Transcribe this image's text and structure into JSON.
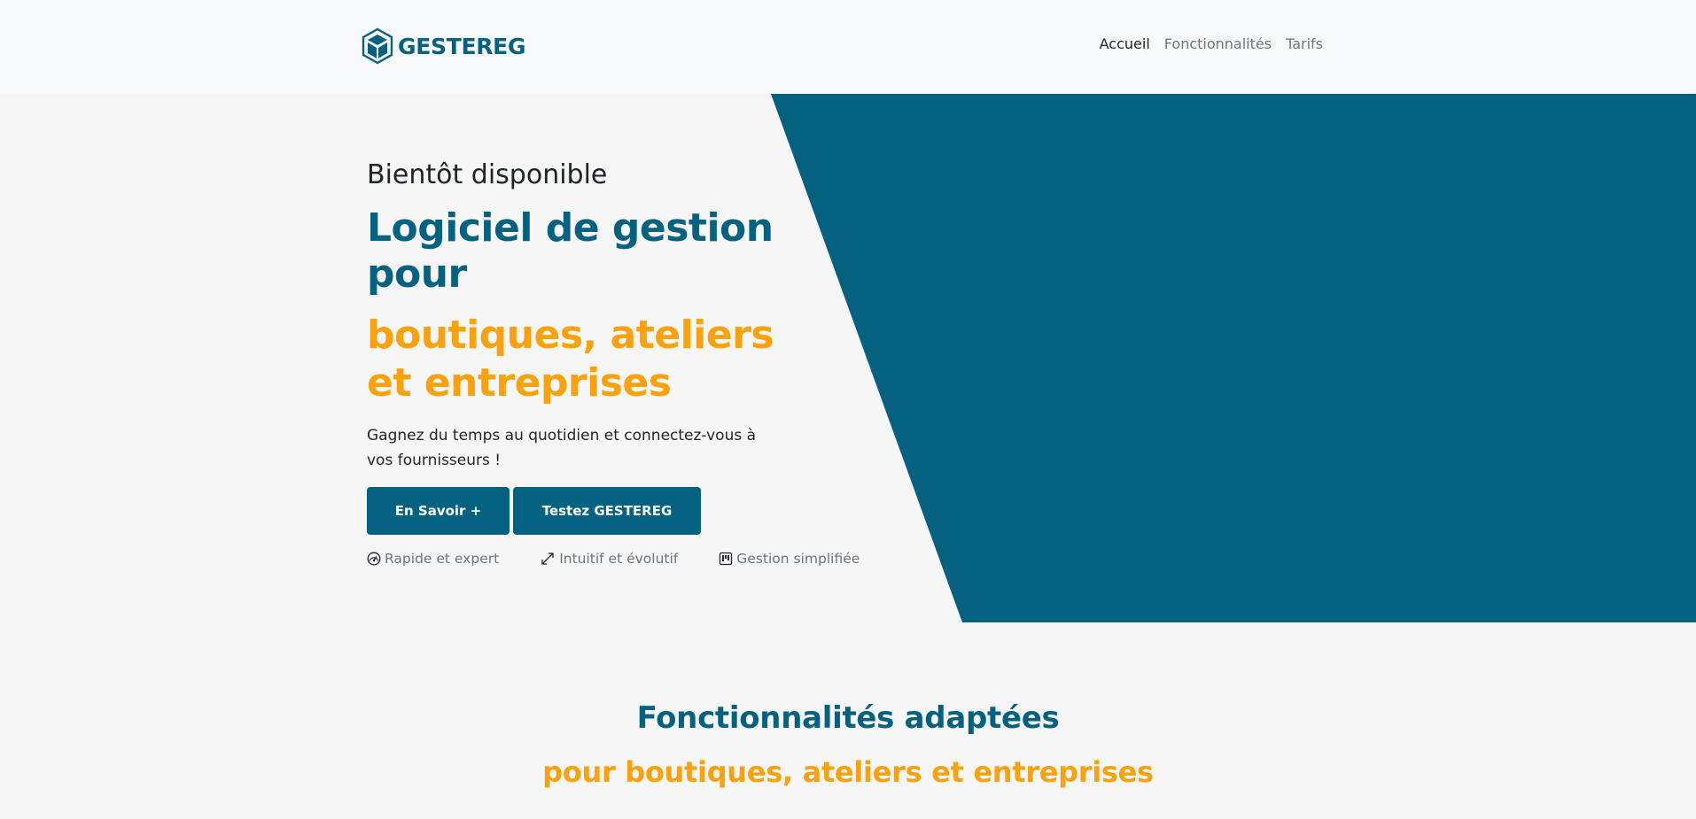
{
  "brand": {
    "name": "GESTEREG",
    "logo_icon": "cube-icon",
    "color": "#056180"
  },
  "nav": {
    "links": [
      {
        "label": "Accueil",
        "active": true
      },
      {
        "label": "Fonctionnalités",
        "active": false
      },
      {
        "label": "Tarifs",
        "active": false
      }
    ]
  },
  "hero": {
    "eyebrow": "Bientôt disponible",
    "title_line1": "Logiciel de gestion pour",
    "title_line2": "boutiques, ateliers et entreprises",
    "lead": "Gagnez du temps au quotidien et connectez-vous à vos fournisseurs !",
    "buttons": {
      "more": "En Savoir +",
      "try": "Testez GESTEREG"
    },
    "features": [
      {
        "icon": "speedometer-icon",
        "label": "Rapide et expert"
      },
      {
        "icon": "expand-arrows-icon",
        "label": "Intuitif et évolutif"
      },
      {
        "icon": "kanban-icon",
        "label": "Gestion simplifiée"
      }
    ]
  },
  "section": {
    "title": "Fonctionnalités adaptées",
    "subtitle": "pour boutiques, ateliers et entreprises"
  },
  "colors": {
    "primary": "#056180",
    "accent": "#f9a20e",
    "background": "#f6f6f7",
    "navbar": "#f8f9fa",
    "muted_text": "#6c757d"
  }
}
